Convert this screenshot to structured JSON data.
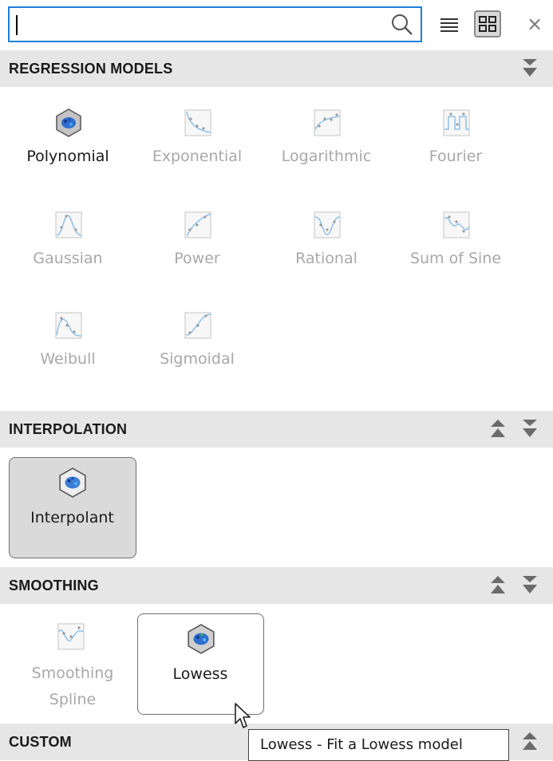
{
  "search": {
    "value": "",
    "placeholder": ""
  },
  "toolbar": {
    "close_label": "×"
  },
  "sections": {
    "regression": {
      "title": "REGRESSION MODELS",
      "items": [
        {
          "label": "Polynomial",
          "enabled": true,
          "icon": "polynomial-fit-icon"
        },
        {
          "label": "Exponential",
          "enabled": false,
          "icon": "exponential-fit-icon"
        },
        {
          "label": "Logarithmic",
          "enabled": false,
          "icon": "logarithmic-fit-icon"
        },
        {
          "label": "Fourier",
          "enabled": false,
          "icon": "fourier-fit-icon"
        },
        {
          "label": "Gaussian",
          "enabled": false,
          "icon": "gaussian-fit-icon"
        },
        {
          "label": "Power",
          "enabled": false,
          "icon": "power-fit-icon"
        },
        {
          "label": "Rational",
          "enabled": false,
          "icon": "rational-fit-icon"
        },
        {
          "label": "Sum of Sine",
          "enabled": false,
          "icon": "sum-of-sine-fit-icon"
        },
        {
          "label": "Weibull",
          "enabled": false,
          "icon": "weibull-fit-icon"
        },
        {
          "label": "Sigmoidal",
          "enabled": false,
          "icon": "sigmoidal-fit-icon"
        }
      ]
    },
    "interpolation": {
      "title": "INTERPOLATION",
      "items": [
        {
          "label": "Interpolant",
          "enabled": true,
          "selected": true,
          "icon": "interpolant-fit-icon"
        }
      ]
    },
    "smoothing": {
      "title": "SMOOTHING",
      "items": [
        {
          "label_line1": "Smoothing",
          "label_line2": "Spline",
          "enabled": false,
          "icon": "smoothing-spline-fit-icon"
        },
        {
          "label": "Lowess",
          "enabled": true,
          "hovered": true,
          "icon": "lowess-fit-icon"
        }
      ]
    },
    "custom": {
      "title": "CUSTOM"
    }
  },
  "tooltip": {
    "text": "Lowess - Fit a Lowess model"
  },
  "colors": {
    "accent": "#1d7fd8",
    "header_bg": "#e6e6e6",
    "selected_bg": "#dadada",
    "disabled_text": "#a8a8a8"
  }
}
